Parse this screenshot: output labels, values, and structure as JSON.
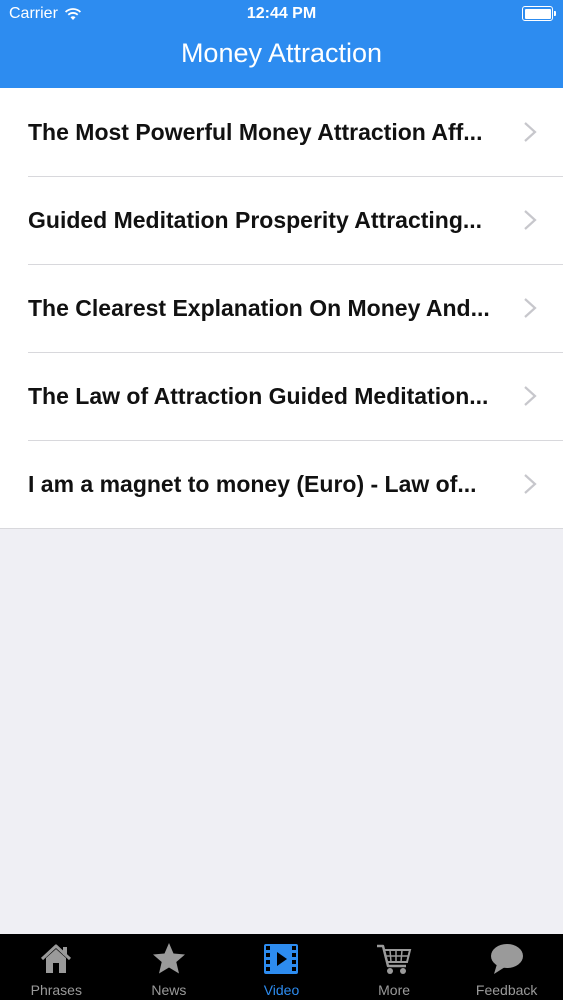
{
  "status_bar": {
    "carrier": "Carrier",
    "time": "12:44 PM"
  },
  "nav": {
    "title": "Money Attraction"
  },
  "videos": [
    {
      "title": "The Most Powerful Money Attraction Aff..."
    },
    {
      "title": "Guided Meditation Prosperity Attracting..."
    },
    {
      "title": "The Clearest Explanation On Money And..."
    },
    {
      "title": "The Law of Attraction Guided Meditation..."
    },
    {
      "title": "I am a magnet to money (Euro) - Law of..."
    }
  ],
  "tabbar": {
    "tabs": [
      {
        "label": "Phrases",
        "icon": "home-icon"
      },
      {
        "label": "News",
        "icon": "star-icon"
      },
      {
        "label": "Video",
        "icon": "film-icon",
        "active": true
      },
      {
        "label": "More",
        "icon": "cart-icon"
      },
      {
        "label": "Feedback",
        "icon": "speech-bubble-icon"
      }
    ]
  },
  "colors": {
    "accent": "#2d8cf0",
    "tab_inactive": "#9a9a9a",
    "background": "#efeff4"
  }
}
